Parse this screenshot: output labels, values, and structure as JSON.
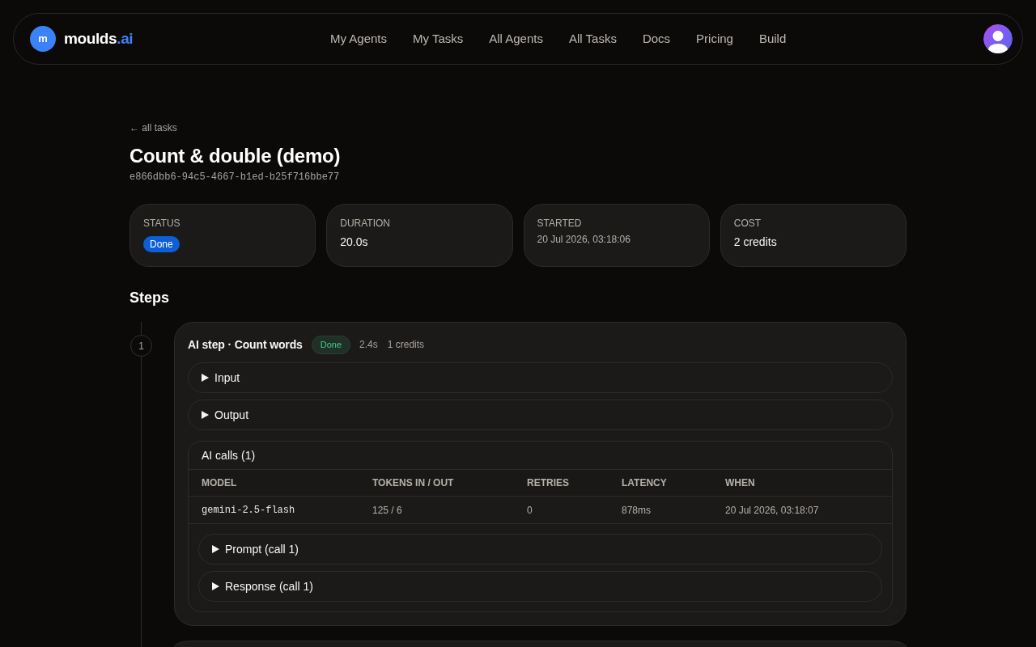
{
  "nav": {
    "logo_mark": "m",
    "logo_name": "moulds",
    "logo_suffix": ".ai",
    "links": [
      "My Agents",
      "My Tasks",
      "All Agents",
      "All Tasks",
      "Docs",
      "Pricing",
      "Build"
    ]
  },
  "back_link": "← all tasks",
  "title": "Count & double (demo)",
  "task_id": "e866dbb6-94c5-4667-b1ed-b25f716bbe77",
  "stats": [
    {
      "label": "STATUS",
      "kind": "badge",
      "color": "#0d5fd8",
      "value": "Done"
    },
    {
      "label": "DURATION",
      "kind": "text",
      "value": "20.0s"
    },
    {
      "label": "STARTED",
      "kind": "muted",
      "value": "20 Jul 2026, 03:18:06"
    },
    {
      "label": "COST",
      "kind": "text",
      "value": "2 credits"
    }
  ],
  "steps_heading": "Steps",
  "steps": [
    {
      "number": "1",
      "title": "AI step · Count words",
      "status": {
        "label": "Done",
        "color": "#3ecf8e"
      },
      "duration": "2.4s",
      "cost": "1 credits",
      "sections": [
        {
          "label": "Input",
          "expanded": false
        },
        {
          "label": "Output",
          "expanded": false
        }
      ],
      "ai_calls": {
        "title": "AI calls (1)",
        "columns": [
          {
            "label": "MODEL",
            "kind": "code"
          },
          {
            "label": "TOKENS IN / OUT",
            "kind": "text"
          },
          {
            "label": "RETRIES",
            "kind": "text"
          },
          {
            "label": "LATENCY",
            "kind": "text"
          },
          {
            "label": "WHEN",
            "kind": "text"
          }
        ],
        "rows": [
          [
            "gemini-2.5-flash",
            "125 / 6",
            "0",
            "878ms",
            "20 Jul 2026, 03:18:07"
          ]
        ],
        "details": [
          {
            "label": "Prompt (call 1)",
            "expanded": false
          },
          {
            "label": "Response (call 1)",
            "expanded": false
          }
        ]
      }
    }
  ]
}
